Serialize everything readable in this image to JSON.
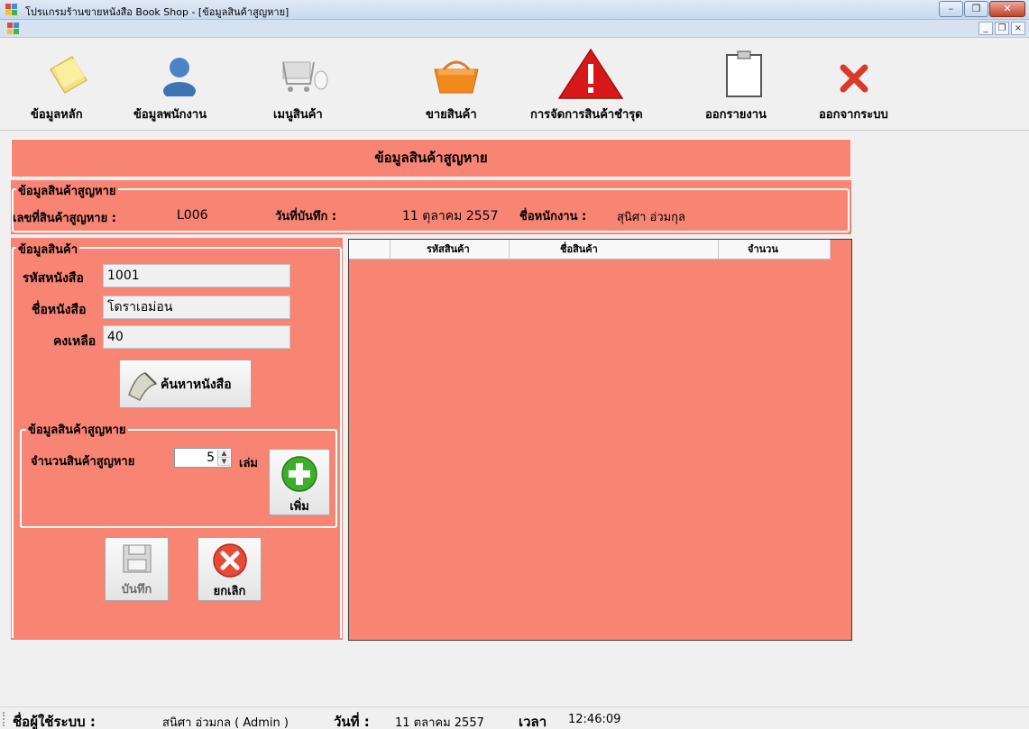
{
  "window": {
    "title": "โปรแกรมร้านขายหนังสือ Book Shop - [ข้อมูลสินค้าสูญหาย]",
    "minimize": "–",
    "maximize": "❐",
    "close": "✕",
    "mdi_minimize": "_",
    "mdi_restore": "❐",
    "mdi_close": "×"
  },
  "toolbar": {
    "items": [
      {
        "label": "ข้อมูลหลัก",
        "icon": "note-icon"
      },
      {
        "label": "ข้อมูลพนักงาน",
        "icon": "user-icon"
      },
      {
        "label": "เมนูสินค้า",
        "icon": "cart-icon"
      },
      {
        "label": "ขายสินค้า",
        "icon": "basket-icon"
      },
      {
        "label": "การจัดการสินค้าชำรุด",
        "icon": "warning-icon"
      },
      {
        "label": "ออกรายงาน",
        "icon": "clipboard-icon"
      },
      {
        "label": "ออกจากระบบ",
        "icon": "exit-icon"
      }
    ]
  },
  "form": {
    "header": "ข้อมูลสินค้าสูญหาย",
    "info_group": {
      "legend": "ข้อมูลสินค้าสูญหาย",
      "lost_no_label": "เลขที่สินค้าสูญหาย :",
      "lost_no_value": "L006",
      "date_label": "วันที่บันทึก :",
      "date_value": "11 ตุลาคม 2557",
      "employee_label": "ชื่อหนักงาน :",
      "employee_value": "สุนิศา อ่วมกุล"
    },
    "product_group": {
      "legend": "ข้อมูลสินค้า",
      "book_code_label": "รหัสหนังสือ",
      "book_code_value": "1001",
      "book_name_label": "ชื่อหนังสือ",
      "book_name_value": "โดราเอม่อน",
      "remaining_label": "คงเหลือ",
      "remaining_value": "40",
      "search_button": "ค้นหาหนังสือ"
    },
    "lost_group": {
      "legend": "ข้อมูลสินค้าสูญหาย",
      "qty_label": "จำนวนสินค้าสูญหาย",
      "qty_value": "5",
      "unit": "เล่ม",
      "add_button": "เพิ่ม"
    },
    "save_button": "บันทึก",
    "cancel_button": "ยกเลิก",
    "grid": {
      "columns": [
        "รหัสสินค้า",
        "ชื่อสินค้า",
        "จำนวน"
      ]
    }
  },
  "status": {
    "user_label": "ชื่อผู้ใช้ระบบ :",
    "user_value": "สนิศา อ่วมกล  ( Admin )",
    "date_label": "วันที่ :",
    "date_value": "11 ตลาคม 2557",
    "time_label": "เวลา",
    "time_value": "12:46:09"
  },
  "colors": {
    "panel": "#f88474",
    "background": "#f0f0f0"
  }
}
